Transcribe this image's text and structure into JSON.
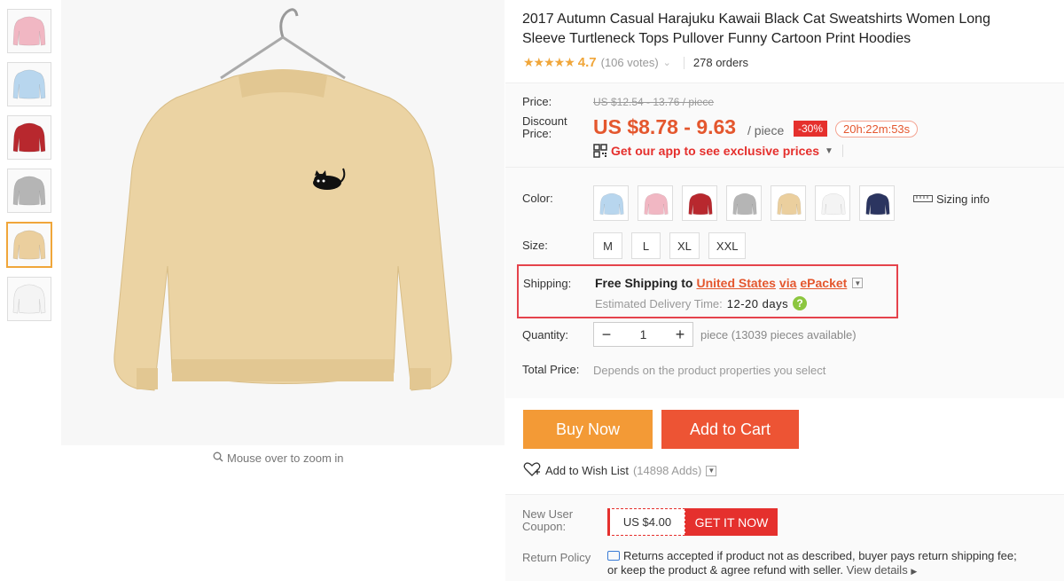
{
  "gallery": {
    "thumbnails": [
      {
        "color": "#f1b7c3"
      },
      {
        "color": "#b8d6ee"
      },
      {
        "color": "#b8282e"
      },
      {
        "color": "#b5b5b5"
      },
      {
        "color": "#ebcf9e"
      },
      {
        "color": "#f4f4f4"
      }
    ],
    "active_index": 4,
    "main_color": "#ebd3a3",
    "zoom_hint": "Mouse over to zoom in"
  },
  "product": {
    "title": "2017 Autumn Casual Harajuku Kawaii Black Cat Sweatshirts Women Long Sleeve Turtleneck Tops Pullover Funny Cartoon Print Hoodies",
    "stars": "★★★★★",
    "rating": "4.7",
    "votes": "(106 votes)",
    "orders": "278 orders"
  },
  "price": {
    "label": "Price:",
    "original": "US $12.54 - 13.76 / piece",
    "discount_label_1": "Discount",
    "discount_label_2": "Price:",
    "discount_price": "US $8.78 - 9.63",
    "per_piece": "/ piece",
    "discount_badge": "-30%",
    "timer": "20h:22m:53s",
    "app_promo": "Get our app to see exclusive prices"
  },
  "options": {
    "color_label": "Color:",
    "colors": [
      {
        "color": "#b8d6ee"
      },
      {
        "color": "#f1b7c3"
      },
      {
        "color": "#b8282e"
      },
      {
        "color": "#b5b5b5"
      },
      {
        "color": "#ebcf9e"
      },
      {
        "color": "#f4f4f4"
      },
      {
        "color": "#2b3560"
      }
    ],
    "sizing_info": "Sizing info",
    "size_label": "Size:",
    "sizes": [
      "M",
      "L",
      "XL",
      "XXL"
    ]
  },
  "shipping": {
    "label": "Shipping:",
    "prefix": "Free Shipping to",
    "country": "United States",
    "via": "via",
    "method": "ePacket",
    "delivery_label": "Estimated Delivery Time:",
    "delivery_days": "12-20 days"
  },
  "quantity": {
    "label": "Quantity:",
    "value": "1",
    "note": "piece (13039 pieces available)"
  },
  "total": {
    "label": "Total Price:",
    "note": "Depends on the product properties you select"
  },
  "actions": {
    "buy_now": "Buy Now",
    "add_to_cart": "Add to Cart",
    "wishlist": "Add to Wish List",
    "wishlist_count": "(14898 Adds)"
  },
  "coupon": {
    "label_1": "New User",
    "label_2": "Coupon:",
    "amount": "US $4.00",
    "cta": "GET IT NOW"
  },
  "returns": {
    "label": "Return Policy",
    "line1": "Returns accepted if product not as described, buyer pays return shipping fee;",
    "line2": "or keep the product & agree refund with seller.",
    "view_details": "View details"
  },
  "colors": {
    "accent_orange": "#e4572e",
    "buy_now": "#f39a36",
    "add_to_cart": "#ed5434",
    "highlight_border": "#e5434c"
  }
}
